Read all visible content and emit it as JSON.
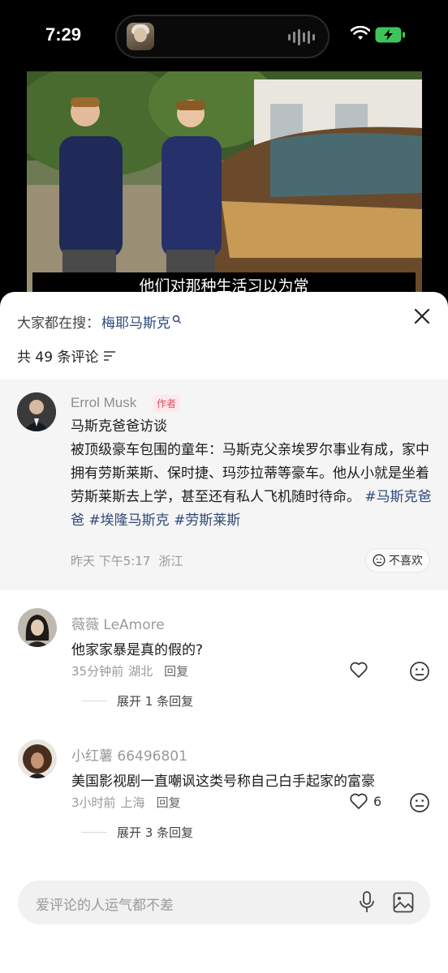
{
  "status": {
    "time": "7:29"
  },
  "video": {
    "subtitle": "他们对那种生活习以为常"
  },
  "header": {
    "search_prefix": "大家都在搜：",
    "search_term": "梅耶马斯克",
    "count_text": "共 49 条评论"
  },
  "pinned": {
    "author": "Errol Musk",
    "badge": "作者",
    "title": "马斯克爸爸访谈",
    "body": "被顶级豪车包围的童年：马斯克父亲埃罗尔事业有成，家中拥有劳斯莱斯、保时捷、玛莎拉蒂等豪车。他从小就是坐着劳斯莱斯去上学，甚至还有私人飞机随时待命。",
    "hashtags": [
      "#马斯克爸爸",
      "#埃隆马斯克",
      "#劳斯莱斯"
    ],
    "time": "昨天 下午5:17",
    "location": "浙江",
    "dislike_label": "不喜欢"
  },
  "comments": [
    {
      "name": "薇薇 LeAmore",
      "text": "他家家暴是真的假的?",
      "time": "35分钟前",
      "location": "湖北",
      "reply_label": "回复",
      "likes": "",
      "expand": "展开 1 条回复"
    },
    {
      "name": "小红薯 66496801",
      "text": "美国影视剧一直嘲讽这类号称自己白手起家的富豪",
      "time": "3小时前",
      "location": "上海",
      "reply_label": "回复",
      "likes": "6",
      "expand": "展开 3 条回复"
    }
  ],
  "input": {
    "placeholder": "爱评论的人运气都不差"
  }
}
